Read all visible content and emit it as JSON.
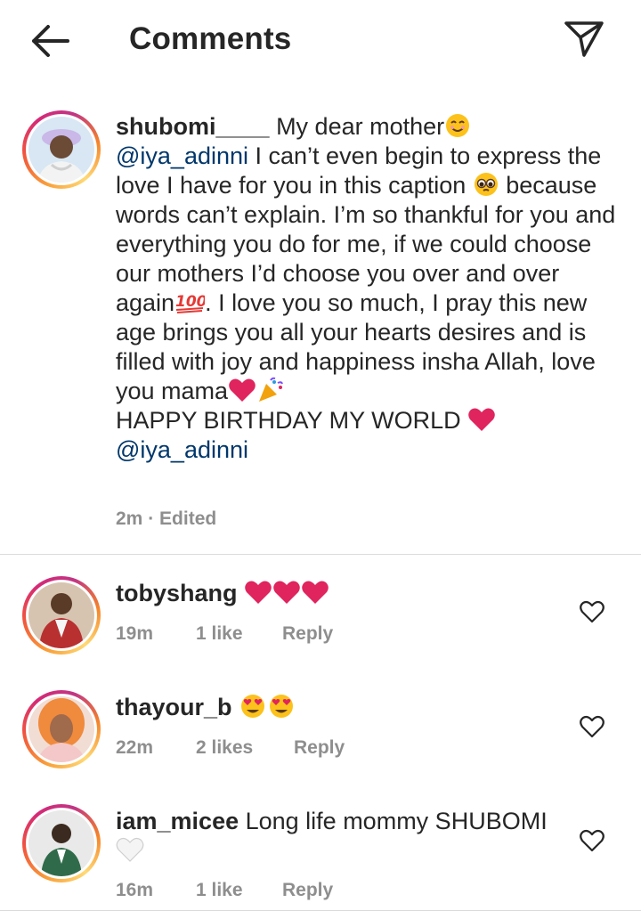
{
  "header": {
    "title": "Comments",
    "back_icon": "arrow-left-icon",
    "send_icon": "paper-plane-icon"
  },
  "caption": {
    "username": "shubomi____",
    "lines": {
      "l1_text": " My dear mother",
      "mention1": "@iya_adinni",
      "l2_text": " I can’t even begin to express the love I have for you in this caption ",
      "l3_text": " because words can’t explain. I’m so thankful for you and everything you do for me, if we could choose our mothers I’d choose you over and over again",
      "l4_text": ". I love you so much, I pray this new age brings you all your hearts desires and is filled with joy and happiness insha Allah, love you mama",
      "l5_text": "HAPPY BIRTHDAY MY WORLD ",
      "mention2": "@iya_adinni"
    },
    "time": "2m",
    "separator": "·",
    "edited": "Edited"
  },
  "comments": [
    {
      "username": "tobyshang",
      "text": "",
      "emojis": "red-heart-icon x3",
      "time": "19m",
      "likes": "1 like",
      "reply": "Reply"
    },
    {
      "username": "thayour_b",
      "text": "",
      "emojis": "heart-eyes-icon x2",
      "time": "22m",
      "likes": "2 likes",
      "reply": "Reply"
    },
    {
      "username": "iam_micee",
      "text": " Long life mommy SHUBOMI",
      "emojis": "white-heart-icon",
      "time": "16m",
      "likes": "1 like",
      "reply": "Reply"
    }
  ],
  "colors": {
    "text": "#262626",
    "mention": "#00376b",
    "muted": "#8e8e8e",
    "divider": "#dbdbdb",
    "heart_red": "#e0245e"
  }
}
